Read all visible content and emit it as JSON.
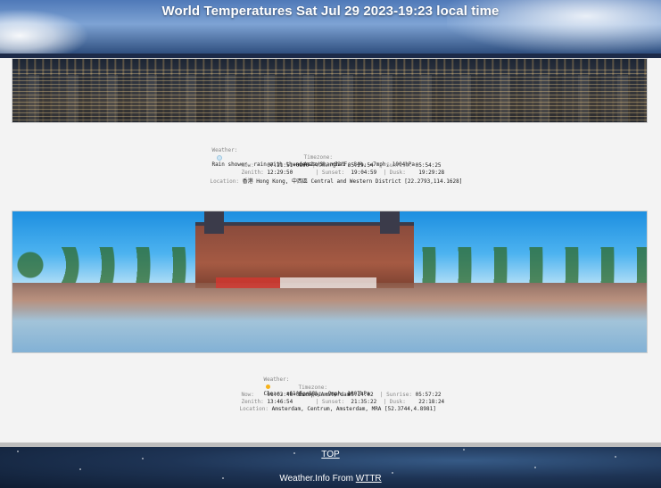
{
  "header": {
    "title": "World Temperatures Sat Jul 29 2023-19:23 local time"
  },
  "cities": [
    {
      "weather_label": "Weather:",
      "weather_icon": "rain-cloud-icon",
      "weather_text": "Rain shower, rain with thunderstorm, +82°F, 84%, ←7mph, 1004hPa",
      "timezone_label": "Timezone:",
      "timezone": "Asia/Shanghai",
      "now_label": "Now:",
      "now": "07:21:51+0800",
      "dawn_label": "Dawn:",
      "dawn": "05:29:54",
      "sunrise_label": "Sunrise:",
      "sunrise": "05:54:25",
      "zenith_label": "Zenith:",
      "zenith": "12:29:50",
      "sunset_label": "Sunset:",
      "sunset": "19:04:59",
      "dusk_label": "Dusk:",
      "dusk": "19:29:28",
      "location_label": "Location:",
      "location": "香港 Hong Kong, 中西區 Central and Western District [22.2793,114.1628]"
    },
    {
      "weather_label": "Weather:",
      "weather_icon": "sun-icon",
      "weather_text": "Clear, +61°F, 88%, ↗9mph, 1007hPa",
      "timezone_label": "Timezone:",
      "timezone": "Europe/Amsterdam",
      "now_label": "Now:",
      "now": "01:03:48+0200",
      "dawn_label": "Dawn:",
      "dawn": "05:14:02",
      "sunrise_label": "Sunrise:",
      "sunrise": "05:57:22",
      "zenith_label": "Zenith:",
      "zenith": "13:46:54",
      "sunset_label": "Sunset:",
      "sunset": "21:35:22",
      "dusk_label": "Dusk:",
      "dusk": "22:18:24",
      "location_label": "Location:",
      "location": "Amsterdam, Centrum, Amsterdam, MRA [52.3744,4.8981]"
    }
  ],
  "footer": {
    "top_link": "TOP",
    "credit_prefix": "Weather.Info From",
    "credit_link": "WTTR"
  }
}
